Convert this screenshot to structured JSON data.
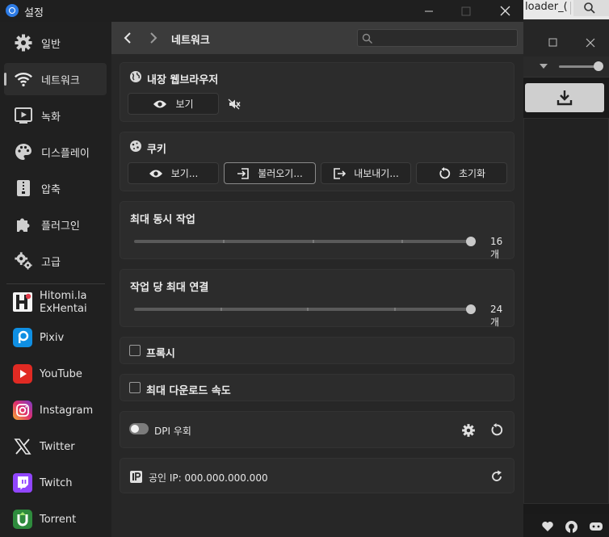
{
  "window": {
    "title": "설정"
  },
  "background_window": {
    "tab_text": "loader_("
  },
  "sidebar": {
    "settings": [
      {
        "label": "일반",
        "icon": "gear-icon"
      },
      {
        "label": "네트워크",
        "icon": "wifi-icon"
      },
      {
        "label": "녹화",
        "icon": "play-box-icon"
      },
      {
        "label": "디스플레이",
        "icon": "palette-icon"
      },
      {
        "label": "압축",
        "icon": "zip-icon"
      },
      {
        "label": "플러그인",
        "icon": "puzzle-icon"
      },
      {
        "label": "고급",
        "icon": "gears-icon"
      }
    ],
    "sites": [
      {
        "label_line1": "Hitomi.la",
        "label_line2": "ExHentai",
        "icon": "hitomi-icon"
      },
      {
        "label": "Pixiv",
        "icon": "pixiv-icon"
      },
      {
        "label": "YouTube",
        "icon": "youtube-icon"
      },
      {
        "label": "Instagram",
        "icon": "instagram-icon"
      },
      {
        "label": "Twitter",
        "icon": "twitter-x-icon"
      },
      {
        "label": "Twitch",
        "icon": "twitch-icon"
      },
      {
        "label": "Torrent",
        "icon": "utorrent-icon"
      }
    ]
  },
  "header": {
    "title": "네트워크",
    "search_placeholder": ""
  },
  "browser": {
    "title": "내장 웹브라우저",
    "view_label": "보기"
  },
  "cookie": {
    "title": "쿠키",
    "view_label": "보기...",
    "import_label": "불러오기...",
    "export_label": "내보내기...",
    "reset_label": "초기화"
  },
  "max_tasks": {
    "title": "최대 동시 작업",
    "value": 16,
    "display": "16 개"
  },
  "max_connections": {
    "title": "작업 당 최대 연결",
    "value": 24,
    "display": "24 개"
  },
  "proxy": {
    "label": "프록시",
    "checked": false
  },
  "speed_limit": {
    "label": "최대 다운로드 속도",
    "checked": false
  },
  "dpi": {
    "label": "DPI 우회",
    "enabled": false
  },
  "ip": {
    "label": "공인 IP: 000.000.000.000"
  },
  "colors": {
    "accent": "#2d7be5",
    "card": "#2c2c2c",
    "header": "#3b3b3b"
  }
}
